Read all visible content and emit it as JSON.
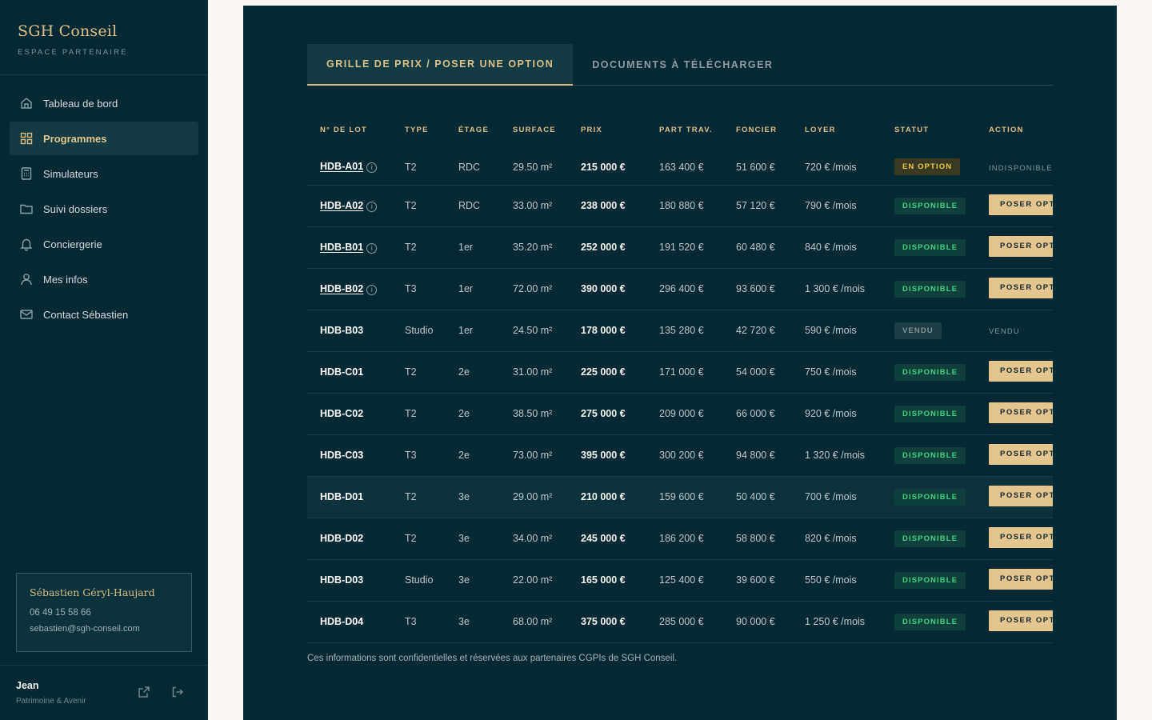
{
  "brand": {
    "name": "SGH Conseil",
    "subtitle": "ESPACE PARTENAIRE"
  },
  "nav": [
    {
      "label": "Tableau de bord",
      "icon": "home-icon",
      "active": false
    },
    {
      "label": "Programmes",
      "icon": "grid-icon",
      "active": true
    },
    {
      "label": "Simulateurs",
      "icon": "calculator-icon",
      "active": false
    },
    {
      "label": "Suivi dossiers",
      "icon": "folder-icon",
      "active": false
    },
    {
      "label": "Conciergerie",
      "icon": "bell-icon",
      "active": false
    },
    {
      "label": "Mes infos",
      "icon": "user-icon",
      "active": false
    },
    {
      "label": "Contact Sébastien",
      "icon": "mail-icon",
      "active": false
    }
  ],
  "contact": {
    "name": "Sébastien Géryl-Haujard",
    "phone": "06 49 15 58 66",
    "email": "sebastien@sgh-conseil.com"
  },
  "user": {
    "name": "Jean",
    "company": "Patrimoine & Avenir"
  },
  "tabs": [
    {
      "label": "GRILLE DE PRIX / POSER UNE OPTION",
      "active": true
    },
    {
      "label": "DOCUMENTS À TÉLÉCHARGER",
      "active": false
    }
  ],
  "table": {
    "headers": [
      "N° DE LOT",
      "TYPE",
      "ÉTAGE",
      "SURFACE",
      "PRIX",
      "PART TRAV.",
      "FONCIER",
      "LOYER",
      "STATUT",
      "ACTION"
    ],
    "rows": [
      {
        "lot": "HDB-A01",
        "info": true,
        "type": "T2",
        "etage": "RDC",
        "surface": "29.50 m²",
        "prix": "215 000 €",
        "part": "163 400 €",
        "foncier": "51 600 €",
        "loyer": "720 € /mois",
        "statut": "EN OPTION",
        "statut_kind": "option",
        "action": "INDISPONIBLE",
        "action_kind": "text"
      },
      {
        "lot": "HDB-A02",
        "info": true,
        "type": "T2",
        "etage": "RDC",
        "surface": "33.00 m²",
        "prix": "238 000 €",
        "part": "180 880 €",
        "foncier": "57 120 €",
        "loyer": "790 € /mois",
        "statut": "DISPONIBLE",
        "statut_kind": "dispo",
        "action": "POSER OPTION",
        "action_kind": "button"
      },
      {
        "lot": "HDB-B01",
        "info": true,
        "type": "T2",
        "etage": "1er",
        "surface": "35.20 m²",
        "prix": "252 000 €",
        "part": "191 520 €",
        "foncier": "60 480 €",
        "loyer": "840 € /mois",
        "statut": "DISPONIBLE",
        "statut_kind": "dispo",
        "action": "POSER OPTION",
        "action_kind": "button"
      },
      {
        "lot": "HDB-B02",
        "info": true,
        "type": "T3",
        "etage": "1er",
        "surface": "72.00 m²",
        "prix": "390 000 €",
        "part": "296 400 €",
        "foncier": "93 600 €",
        "loyer": "1 300 € /mois",
        "statut": "DISPONIBLE",
        "statut_kind": "dispo",
        "action": "POSER OPTION",
        "action_kind": "button"
      },
      {
        "lot": "HDB-B03",
        "info": false,
        "type": "Studio",
        "etage": "1er",
        "surface": "24.50 m²",
        "prix": "178 000 €",
        "part": "135 280 €",
        "foncier": "42 720 €",
        "loyer": "590 € /mois",
        "statut": "VENDU",
        "statut_kind": "vendu",
        "action": "VENDU",
        "action_kind": "text"
      },
      {
        "lot": "HDB-C01",
        "info": false,
        "type": "T2",
        "etage": "2e",
        "surface": "31.00 m²",
        "prix": "225 000 €",
        "part": "171 000 €",
        "foncier": "54 000 €",
        "loyer": "750 € /mois",
        "statut": "DISPONIBLE",
        "statut_kind": "dispo",
        "action": "POSER OPTION",
        "action_kind": "button"
      },
      {
        "lot": "HDB-C02",
        "info": false,
        "type": "T2",
        "etage": "2e",
        "surface": "38.50 m²",
        "prix": "275 000 €",
        "part": "209 000 €",
        "foncier": "66 000 €",
        "loyer": "920 € /mois",
        "statut": "DISPONIBLE",
        "statut_kind": "dispo",
        "action": "POSER OPTION",
        "action_kind": "button"
      },
      {
        "lot": "HDB-C03",
        "info": false,
        "type": "T3",
        "etage": "2e",
        "surface": "73.00 m²",
        "prix": "395 000 €",
        "part": "300 200 €",
        "foncier": "94 800 €",
        "loyer": "1 320 € /mois",
        "statut": "DISPONIBLE",
        "statut_kind": "dispo",
        "action": "POSER OPTION",
        "action_kind": "button"
      },
      {
        "lot": "HDB-D01",
        "info": false,
        "type": "T2",
        "etage": "3e",
        "surface": "29.00 m²",
        "prix": "210 000 €",
        "part": "159 600 €",
        "foncier": "50 400 €",
        "loyer": "700 € /mois",
        "statut": "DISPONIBLE",
        "statut_kind": "dispo",
        "action": "POSER OPTION",
        "action_kind": "button",
        "highlight": true
      },
      {
        "lot": "HDB-D02",
        "info": false,
        "type": "T2",
        "etage": "3e",
        "surface": "34.00 m²",
        "prix": "245 000 €",
        "part": "186 200 €",
        "foncier": "58 800 €",
        "loyer": "820 € /mois",
        "statut": "DISPONIBLE",
        "statut_kind": "dispo",
        "action": "POSER OPTION",
        "action_kind": "button"
      },
      {
        "lot": "HDB-D03",
        "info": false,
        "type": "Studio",
        "etage": "3e",
        "surface": "22.00 m²",
        "prix": "165 000 €",
        "part": "125 400 €",
        "foncier": "39 600 €",
        "loyer": "550 € /mois",
        "statut": "DISPONIBLE",
        "statut_kind": "dispo",
        "action": "POSER OPTION",
        "action_kind": "button"
      },
      {
        "lot": "HDB-D04",
        "info": false,
        "type": "T3",
        "etage": "3e",
        "surface": "68.00 m²",
        "prix": "375 000 €",
        "part": "285 000 €",
        "foncier": "90 000 €",
        "loyer": "1 250 € /mois",
        "statut": "DISPONIBLE",
        "statut_kind": "dispo",
        "action": "POSER OPTION",
        "action_kind": "button"
      }
    ]
  },
  "footnote": "Ces informations sont confidentielles et réservées aux partenaires CGPIs de SGH Conseil.",
  "colors": {
    "sidebar_bg": "#062a33",
    "accent_gold": "#dcc08a",
    "status_green": "#3fd07f",
    "status_yellow": "#e5c84a"
  }
}
